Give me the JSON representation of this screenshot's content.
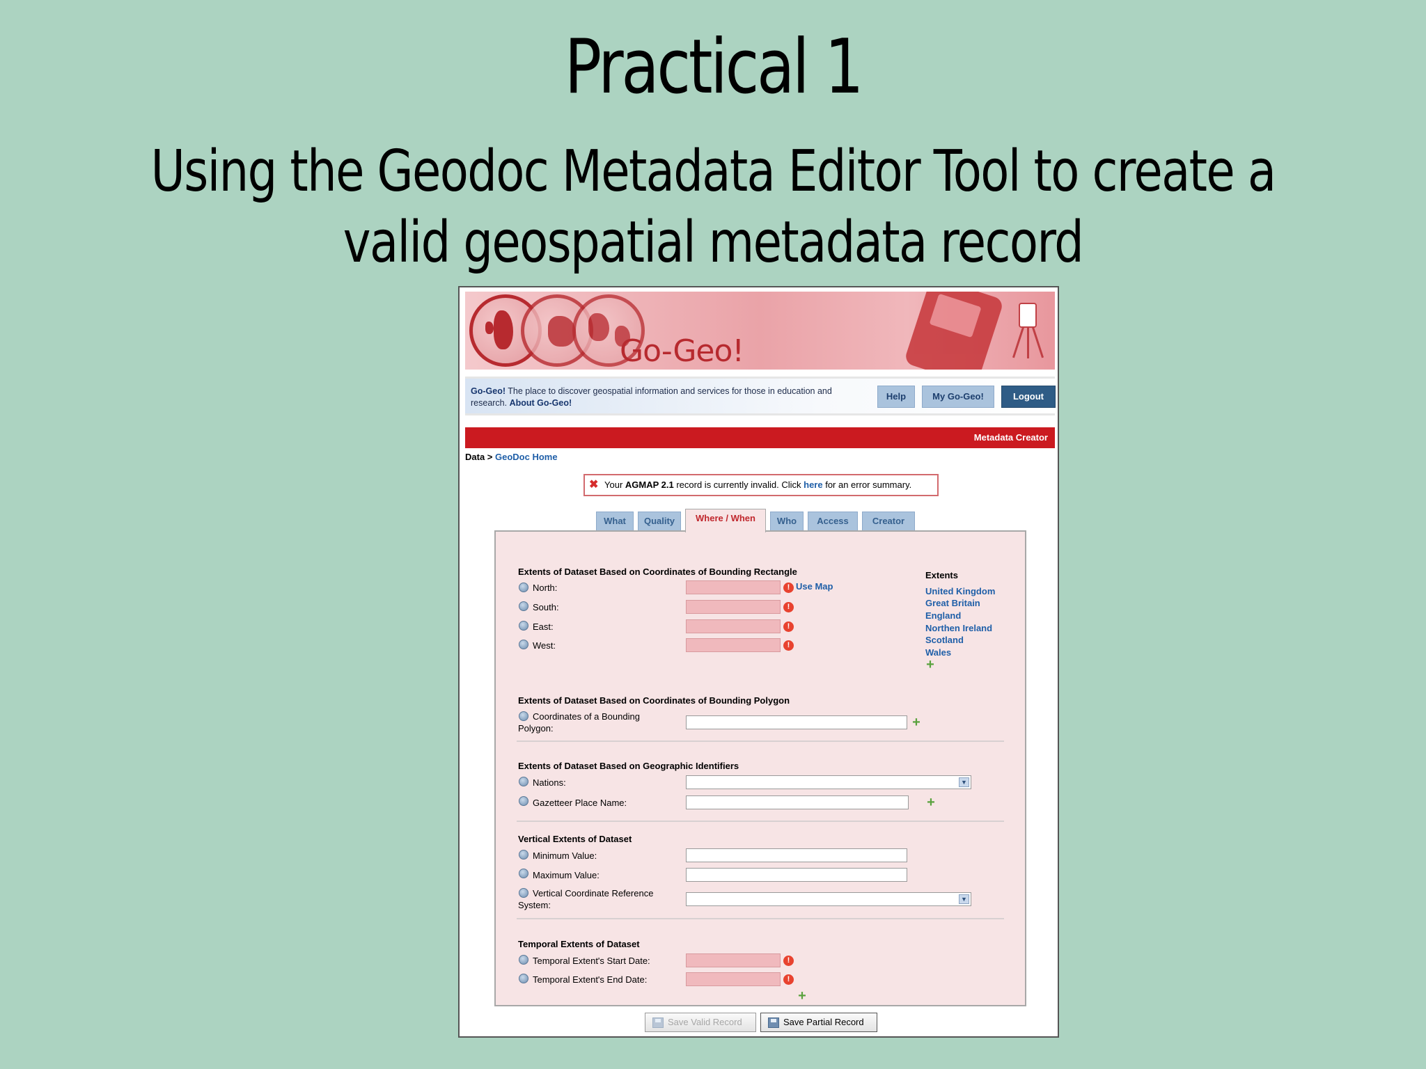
{
  "slide": {
    "title": "Practical 1",
    "subtitle_line1": "Using the Geodoc Metadata Editor Tool to create a",
    "subtitle_line2": "valid geospatial metadata record"
  },
  "app": {
    "logo": "Go-Geo!",
    "info_brand": "Go-Geo!",
    "info_text": " The place to discover geospatial information and services for those in education and research. ",
    "info_link": "About Go-Geo!",
    "nav": {
      "help": "Help",
      "my": "My Go-Geo!",
      "logout": "Logout"
    },
    "section_bar": "Metadata Creator",
    "breadcrumb": {
      "root": "Data",
      "sep": " > ",
      "link": "GeoDoc Home"
    },
    "error": {
      "pre": "Your ",
      "std": "AGMAP 2.1",
      "mid": " record is currently invalid. Click ",
      "link": "here",
      "post": " for an error summary."
    },
    "tabs": [
      "What",
      "Quality",
      "Where / When",
      "Who",
      "Access",
      "Creator"
    ],
    "active_tab": "Where / When",
    "rect": {
      "title": "Extents of Dataset Based on Coordinates of Bounding Rectangle",
      "north": "North:",
      "south": "South:",
      "east": "East:",
      "west": "West:",
      "use_map": "Use Map"
    },
    "extents": {
      "title": "Extents",
      "items": [
        "United Kingdom",
        "Great Britain",
        "England",
        "Northen Ireland",
        "Scotland",
        "Wales"
      ]
    },
    "polygon": {
      "title": "Extents of Dataset Based on Coordinates of Bounding Polygon",
      "label_1": "Coordinates of a Bounding",
      "label_2": "Polygon:"
    },
    "geo": {
      "title": "Extents of Dataset Based on Geographic Identifiers",
      "nations": "Nations:",
      "gazetteer": "Gazetteer Place Name:"
    },
    "vertical": {
      "title": "Vertical Extents of Dataset",
      "min": "Minimum Value:",
      "max": "Maximum Value:",
      "crs_1": "Vertical Coordinate Reference",
      "crs_2": "System:"
    },
    "temporal": {
      "title": "Temporal Extents of Dataset",
      "start": "Temporal Extent's Start Date:",
      "end": "Temporal Extent's End Date:"
    },
    "buttons": {
      "save_valid": "Save Valid Record",
      "save_partial": "Save Partial Record"
    }
  }
}
